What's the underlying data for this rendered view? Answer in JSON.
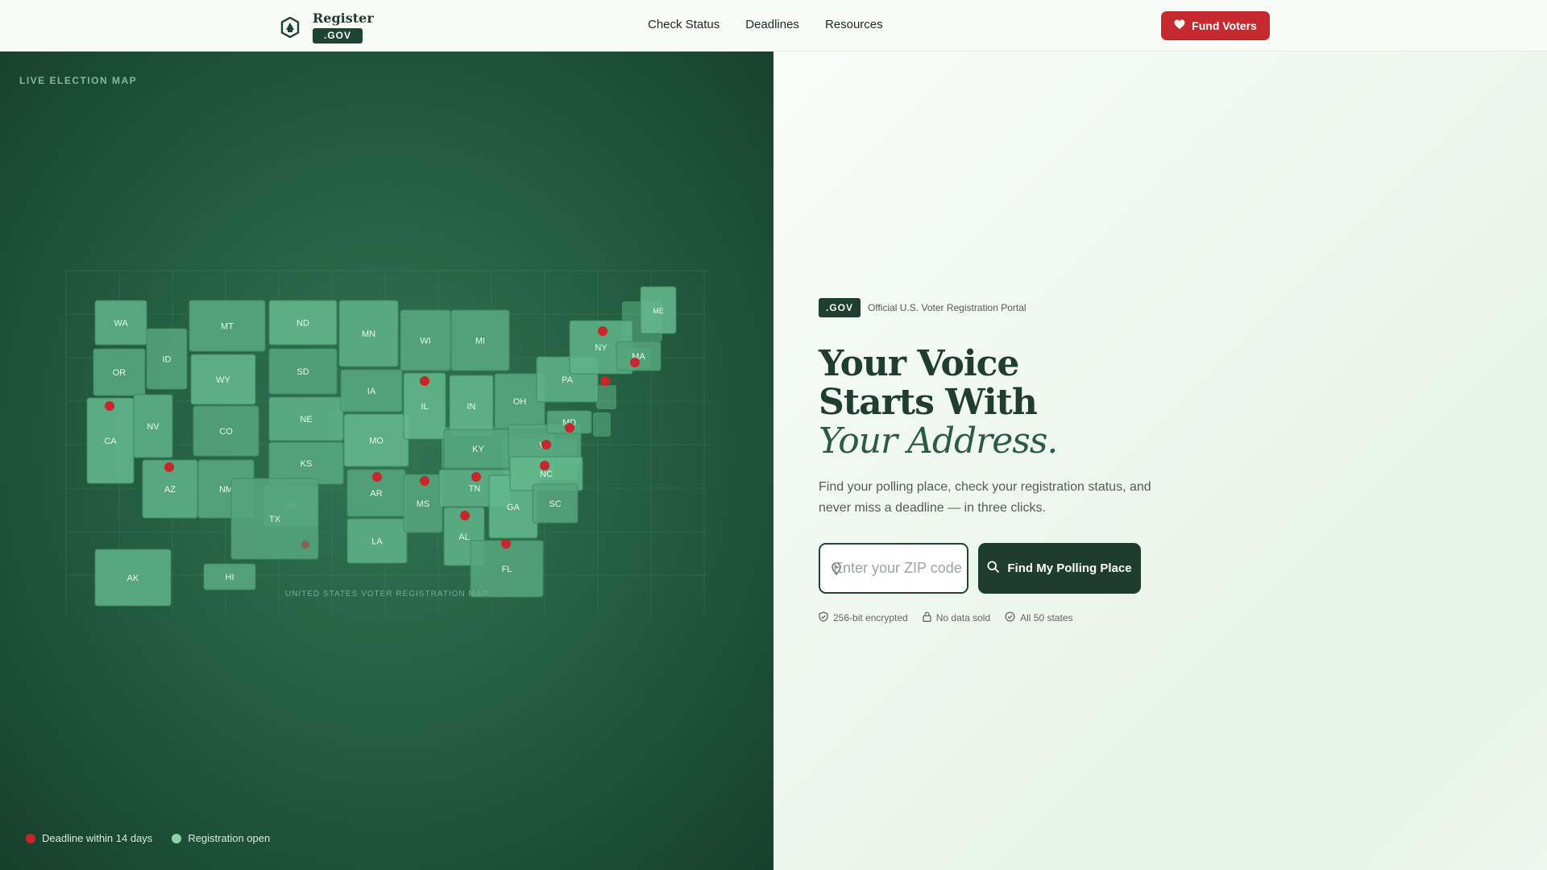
{
  "nav": {
    "brand_name": "Register",
    "brand_gov": ".GOV",
    "links": [
      "Check Status",
      "Deadlines",
      "Resources"
    ],
    "fund_label": "Fund Voters"
  },
  "map": {
    "label": "LIVE ELECTION MAP",
    "caption": "UNITED STATES VOTER REGISTRATION MAP",
    "states": [
      "WA",
      "OR",
      "CA",
      "ID",
      "NV",
      "MT",
      "WY",
      "CO",
      "AZ",
      "NM",
      "ND",
      "SD",
      "NE",
      "KS",
      "OK",
      "TX",
      "MN",
      "IA",
      "MO",
      "AR",
      "LA",
      "WI",
      "IL",
      "MS",
      "AL",
      "MI",
      "IN",
      "KY",
      "TN",
      "OH",
      "GA",
      "FL",
      "PA",
      "VA",
      "NC",
      "SC",
      "NY",
      "MD",
      "ME",
      "MA",
      "AK",
      "HI"
    ],
    "deadline_states": [
      "CA",
      "AZ",
      "OK",
      "IL",
      "AR",
      "MS",
      "AL",
      "TN",
      "GA",
      "VA",
      "NC",
      "MD",
      "NY",
      "PA",
      "MA"
    ],
    "legend": {
      "deadline": "Deadline within 14 days",
      "open": "Registration open"
    },
    "colors": {
      "deadline": "#c8262b",
      "open": "#8fd4aa"
    }
  },
  "hero": {
    "badge": ".GOV",
    "badge_text": "Official U.S. Voter Registration Portal",
    "headline_1": "Your Voice",
    "headline_2": "Starts With",
    "headline_3": "Your Address.",
    "lead": "Find your polling place, check your registration status, and never miss a deadline — in three clicks.",
    "zip_placeholder": "Enter your ZIP code",
    "find_label": "Find My Polling Place",
    "trust": [
      "256-bit encrypted",
      "No data sold",
      "All 50 states"
    ]
  }
}
